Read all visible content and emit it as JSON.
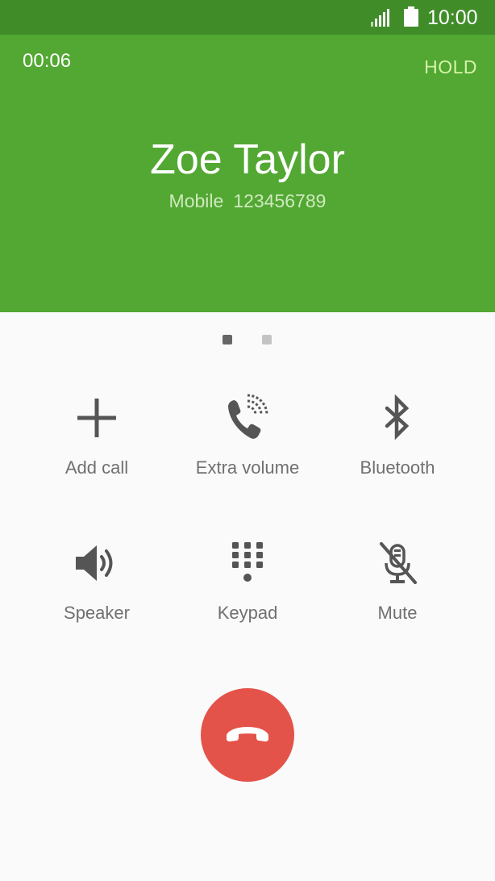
{
  "status_bar": {
    "time": "10:00",
    "icons": [
      "signal-icon",
      "battery-icon"
    ]
  },
  "call": {
    "timer": "00:06",
    "hold_label": "HOLD",
    "caller_name": "Zoe Taylor",
    "number_type": "Mobile",
    "number": "123456789"
  },
  "pager": {
    "pages": 2,
    "active_index": 0
  },
  "actions": [
    {
      "label": "Add call",
      "icon": "plus-icon"
    },
    {
      "label": "Extra volume",
      "icon": "extra-volume-icon"
    },
    {
      "label": "Bluetooth",
      "icon": "bluetooth-icon"
    },
    {
      "label": "Speaker",
      "icon": "speaker-icon"
    },
    {
      "label": "Keypad",
      "icon": "keypad-icon"
    },
    {
      "label": "Mute",
      "icon": "mute-icon"
    }
  ],
  "end_call": {
    "icon": "end-call-icon"
  },
  "colors": {
    "status_bar": "#3f8c29",
    "header": "#52a832",
    "hold": "#d4f3a8",
    "end_call": "#e3534a",
    "icon": "#555555",
    "label": "#707070"
  }
}
